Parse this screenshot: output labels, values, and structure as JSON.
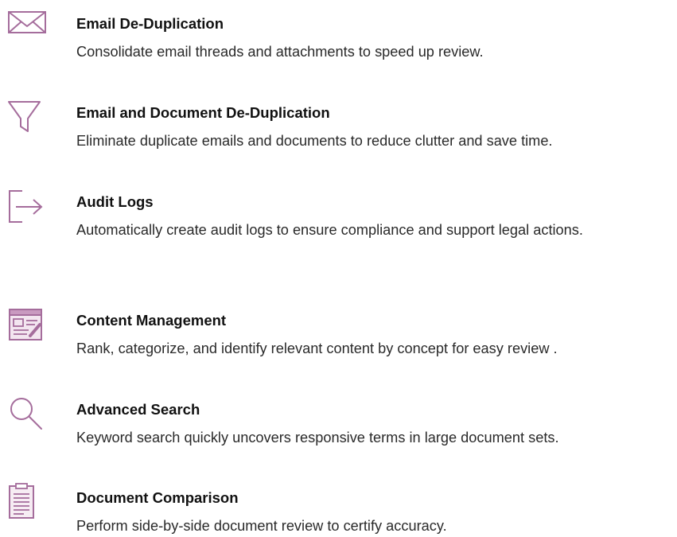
{
  "accent_color": "#9e5a95",
  "features": [
    {
      "icon": "envelope-icon",
      "title": "Email De-Duplication",
      "description": "Consolidate email threads and attachments to speed up review."
    },
    {
      "icon": "funnel-icon",
      "title": "Email and Document De-Duplication",
      "description": "Eliminate duplicate emails and documents to reduce clutter and save time."
    },
    {
      "icon": "exit-arrow-icon",
      "title": "Audit Logs",
      "description": "Automatically create audit logs to ensure compliance and support legal actions."
    },
    {
      "icon": "content-window-icon",
      "title": "Content Management",
      "description": "Rank, categorize, and identify relevant content by concept for easy review ."
    },
    {
      "icon": "magnifier-icon",
      "title": "Advanced Search",
      "description": "Keyword search quickly uncovers responsive terms in large document sets."
    },
    {
      "icon": "document-icon",
      "title": "Document Comparison",
      "description": "Perform side-by-side document review to certify accuracy."
    }
  ]
}
